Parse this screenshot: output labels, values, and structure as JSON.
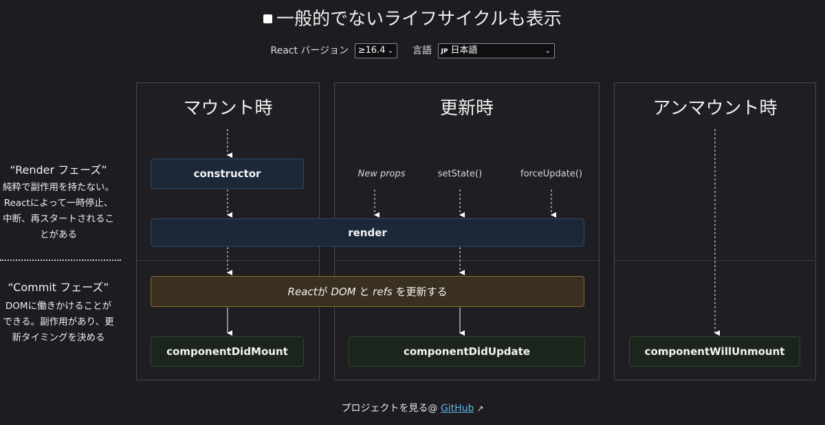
{
  "header": {
    "toggle_label": "一般的でないライフサイクルも表示"
  },
  "controls": {
    "version_label": "React バージョン",
    "version_value": "≥16.4",
    "language_label": "言語",
    "language_flag": "JP",
    "language_value": "日本語"
  },
  "phases": {
    "render_title": "“Render フェーズ”",
    "render_desc": "純粋で副作用を持たない。Reactによって一時停止、中断、再スタートされることがある",
    "commit_title": "“Commit フェーズ”",
    "commit_desc": "DOMに働きかけることができる。副作用があり、更新タイミングを決める"
  },
  "columns": {
    "mount": "マウント時",
    "update": "更新時",
    "unmount": "アンマウント時"
  },
  "triggers": {
    "new_props": "New props",
    "set_state": "setState()",
    "force_update": "forceUpdate()"
  },
  "methods": {
    "constructor": "constructor",
    "render": "render",
    "commit_part1": "React",
    "commit_part2": "が ",
    "commit_part3": "DOM",
    "commit_part4": " と ",
    "commit_part5": "refs",
    "commit_part6": " を更新する",
    "did_mount": "componentDidMount",
    "did_update": "componentDidUpdate",
    "will_unmount": "componentWillUnmount"
  },
  "footer": {
    "text": "プロジェクトを見る@ ",
    "link": "GitHub",
    "ext_icon": "external-link-icon"
  },
  "colors": {
    "background": "#1c1c21",
    "render_box": "#1c2838",
    "commit_box": "#3a3020",
    "lifecycle_box": "#1c251c",
    "link": "#61b4e8"
  }
}
